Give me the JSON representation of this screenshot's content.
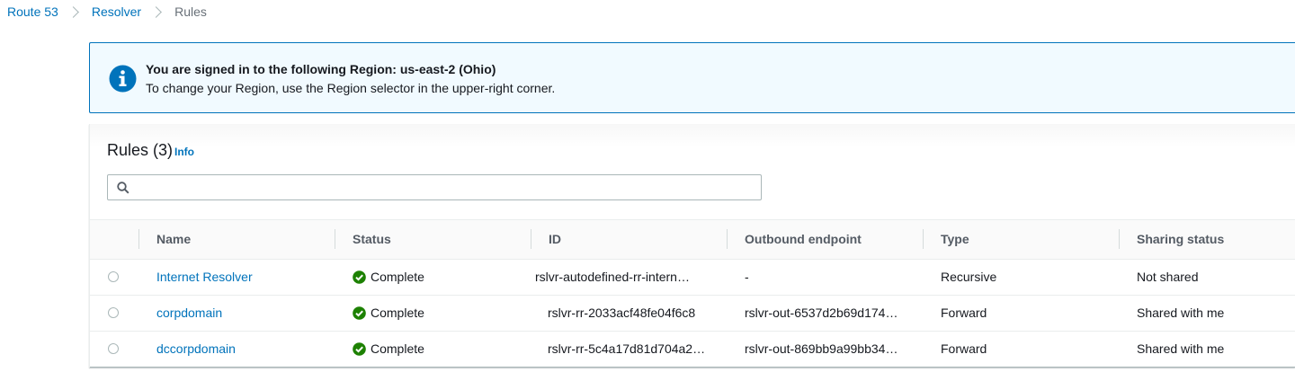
{
  "breadcrumb": {
    "items": [
      {
        "label": "Route 53"
      },
      {
        "label": "Resolver"
      },
      {
        "label": "Rules"
      }
    ]
  },
  "banner": {
    "icon": "info-icon",
    "title": "You are signed in to the following Region: us-east-2 (Ohio)",
    "text": "To change your Region, use the Region selector in the upper-right corner."
  },
  "rules": {
    "title": "Rules (3)",
    "info_label": "Info",
    "search": {
      "value": "",
      "placeholder": ""
    },
    "columns": [
      "Name",
      "Status",
      "ID",
      "Outbound endpoint",
      "Type",
      "Sharing status"
    ],
    "rows": [
      {
        "name": "Internet Resolver",
        "status": "Complete",
        "id": "rslvr-autodefined-rr-intern…",
        "outbound_endpoint": "-",
        "type": "Recursive",
        "sharing_status": "Not shared"
      },
      {
        "name": "corpdomain",
        "status": "Complete",
        "id": "rslvr-rr-2033acf48fe04f6c8",
        "outbound_endpoint": "rslvr-out-6537d2b69d174…",
        "type": "Forward",
        "sharing_status": "Shared with me"
      },
      {
        "name": "dccorpdomain",
        "status": "Complete",
        "id": "rslvr-rr-5c4a17d81d704a2…",
        "outbound_endpoint": "rslvr-out-869bb9a99bb34…",
        "type": "Forward",
        "sharing_status": "Shared with me"
      }
    ]
  },
  "colors": {
    "link": "#0073bb",
    "success": "#1d8102",
    "banner_bg": "#f1faff",
    "banner_border": "#0073bb"
  }
}
